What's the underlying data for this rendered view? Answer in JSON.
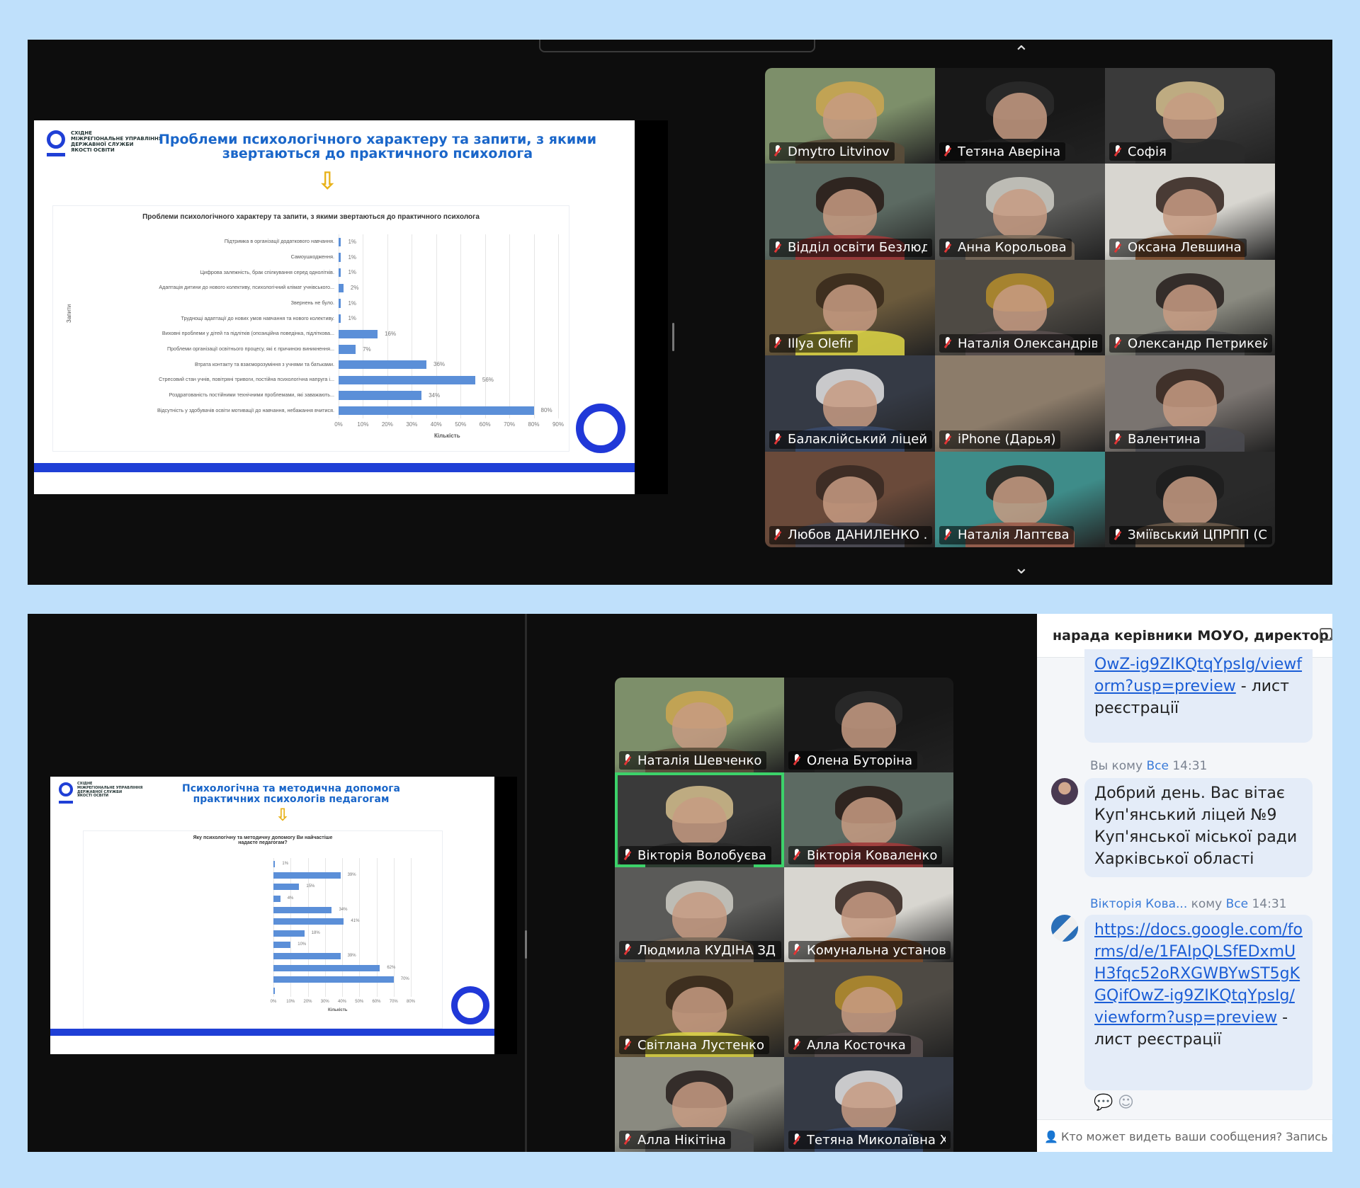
{
  "panel1": {
    "slide": {
      "logo_text": "СХІДНЕ\nМІЖРЕГІОНАЛЬНЕ УПРАВЛІННЯ\nДЕРЖАВНОЇ СЛУЖБИ\nЯКОСТІ ОСВІТИ",
      "title": "Проблеми психологічного характеру та запити, з якими звертаються до практичного психолога",
      "chart_title": "Проблеми психологічного характеру та запити, з якими звертаються до практичного психолога",
      "xlabel": "Кількість",
      "ylabel": "Запити",
      "ticks": [
        "0%",
        "10%",
        "20%",
        "30%",
        "40%",
        "50%",
        "60%",
        "70%",
        "80%",
        "90%"
      ]
    },
    "participants": [
      {
        "name": "Dmytro Litvinov"
      },
      {
        "name": "Тетяна Аверіна"
      },
      {
        "name": "Софія"
      },
      {
        "name": "Відділ освіти Безлюді..."
      },
      {
        "name": "Анна Корольова"
      },
      {
        "name": "Оксана Левшина"
      },
      {
        "name": "Illya Olefir"
      },
      {
        "name": "Наталія Олександрівна"
      },
      {
        "name": "Олександр Петрикей"
      },
      {
        "name": "Балаклійський ліцей ..."
      },
      {
        "name": "iPhone (Дарья)"
      },
      {
        "name": "Валентина"
      },
      {
        "name": "Любов ДАНИЛЕНКО ..."
      },
      {
        "name": "Наталія Лаптєва"
      },
      {
        "name": "Зміївський ЦПРПП (С..."
      }
    ]
  },
  "panel2": {
    "slide": {
      "logo_text": "СХІДНЕ\nМІЖРЕГІОНАЛЬНЕ УПРАВЛІННЯ\nДЕРЖАВНОЇ СЛУЖБИ\nЯКОСТІ ОСВІТИ",
      "title": "Психологічна та методична допомога практичних психологів педагогам",
      "chart_title": "Яку психологічну та методичну допомогу Ви найчастіше надаєте педагогам?",
      "xlabel": "Кількість",
      "ticks": [
        "0%",
        "10%",
        "20%",
        "30%",
        "40%",
        "50%",
        "60%",
        "70%",
        "80%"
      ]
    },
    "participants": [
      {
        "name": "Наталія Шевченко"
      },
      {
        "name": "Олена Буторіна"
      },
      {
        "name": "Вікторія  Волобуєва"
      },
      {
        "name": "Вікторія Коваленко"
      },
      {
        "name": "Людмила КУДІНА ЗД..."
      },
      {
        "name": "Комунальна установа..."
      },
      {
        "name": "Світлана  Лустенко"
      },
      {
        "name": "Алла Косточка"
      },
      {
        "name": "Алла Нікітіна"
      },
      {
        "name": "Тетяна Миколаївна Х..."
      }
    ],
    "chat": {
      "title": "нарада керівники МОУО, директор...",
      "msg0_link": "OwZ-ig9ZIKQtqYpsIg/viewform?usp=preview",
      "msg0_suffix": " - лист реєстрації",
      "msg1_sender": "Вы",
      "msg1_to": "кому",
      "msg1_scope": "Все",
      "msg1_time": "14:31",
      "msg1_text": "Добрий день. Вас вітає Куп'янський ліцей №9 Куп'янської міської ради Харківської області",
      "msg2_sender": "Вікторія Кова...",
      "msg2_to": "кому",
      "msg2_scope": "Все",
      "msg2_time": "14:31",
      "msg2_link": "https://docs.google.com/forms/d/e/1FAIpQLSfEDxmUH3fqc52oRXGWBYwST5gKGQifOwZ-ig9ZIKQtqYpsIg/viewform?usp=preview",
      "msg2_suffix": " - лист реєстрації",
      "footer": "Кто может видеть ваши сообщения? Запись вк"
    }
  },
  "chart_data": [
    {
      "type": "bar",
      "title": "Проблеми психологічного характеру та запити, з якими звертаються до практичного психолога",
      "xlabel": "Кількість",
      "ylabel": "Запити",
      "xlim": [
        0,
        90
      ],
      "categories": [
        "Підтримка в організації додаткового навчання.",
        "Самоушкодження.",
        "Цифрова залежність, брак спілкування серед однолітків.",
        "Адаптація дитини до нового колективу, психологічний клімат учнівського...",
        "Звернень не було.",
        "Труднощі адаптації до нових умов навчання та нового колективу.",
        "Виховні проблеми у дітей та підлітків (опозиційна поведінка, підліткова...",
        "Проблеми організації освітнього процесу, які є причиною виникнення...",
        "Втрата контакту та взаєморозуміння з учнями та батьками.",
        "Стресовий стан учнів, повітряні тривоги, постійна психологічна напруга і...",
        "Роздратованість постійними технічними проблемами, які заважають...",
        "Відсутність у здобувачів освіти мотивації до навчання, небажання вчитися."
      ],
      "values": [
        1,
        1,
        1,
        2,
        1,
        1,
        16,
        7,
        36,
        56,
        34,
        80
      ],
      "labels": [
        "1%",
        "1%",
        "1%",
        "2%",
        "1%",
        "1%",
        "16%",
        "7%",
        "36%",
        "56%",
        "34%",
        "80%"
      ]
    },
    {
      "type": "bar",
      "title": "Яку психологічну та методичну допомогу Ви найчастіше надаєте педагогам?",
      "xlabel": "Кількість",
      "xlim": [
        0,
        80
      ],
      "categories": [
        "",
        "",
        "",
        "",
        "",
        "",
        "",
        "",
        "",
        "",
        "",
        ""
      ],
      "values": [
        1,
        39,
        15,
        4,
        34,
        41,
        18,
        10,
        39,
        62,
        70,
        0
      ],
      "labels": [
        "1%",
        "39%",
        "15%",
        "4%",
        "34%",
        "41%",
        "18%",
        "10%",
        "39%",
        "62%",
        "70%",
        ""
      ]
    }
  ],
  "colors": {
    "accent": "#1f3fd6",
    "bar": "#5b8fd8",
    "title": "#1a66c9",
    "mic": "#e03535",
    "link": "#1a5dd6"
  }
}
